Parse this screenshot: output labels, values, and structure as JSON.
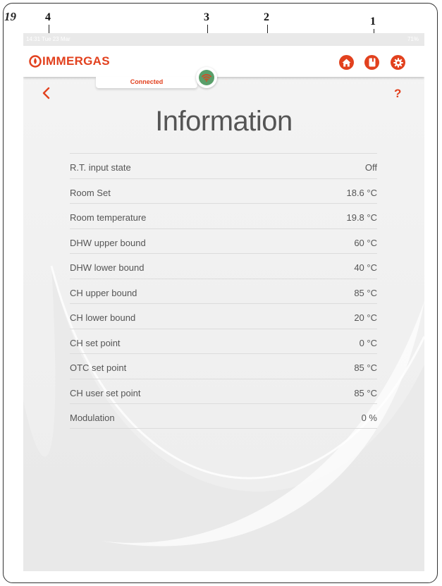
{
  "figure": {
    "number": "19",
    "callouts": [
      "1",
      "2",
      "3",
      "4"
    ]
  },
  "statusbar": {
    "time": "14:31  Tue 23 Mar",
    "battery": "71%"
  },
  "header": {
    "logo_text": "IMMERGAS",
    "icons": [
      "home-icon",
      "manual-icon",
      "settings-icon"
    ]
  },
  "connection": {
    "status": "Connected",
    "icon": "wifi-icon",
    "color": "#5a9f6a"
  },
  "nav": {
    "back_icon": "chevron-left-icon",
    "help_label": "?"
  },
  "page": {
    "title": "Information"
  },
  "info_rows": [
    {
      "label": "R.T. input state",
      "value": "Off"
    },
    {
      "label": "Room Set",
      "value": "18.6 °C"
    },
    {
      "label": "Room temperature",
      "value": "19.8 °C"
    },
    {
      "label": "DHW upper bound",
      "value": "60 °C"
    },
    {
      "label": "DHW lower bound",
      "value": "40 °C"
    },
    {
      "label": "CH upper bound",
      "value": "85 °C"
    },
    {
      "label": "CH lower bound",
      "value": "20 °C"
    },
    {
      "label": "CH set point",
      "value": "0 °C"
    },
    {
      "label": "OTC set point",
      "value": "85 °C"
    },
    {
      "label": "CH user set point",
      "value": "85 °C"
    },
    {
      "label": "Modulation",
      "value": "0 %"
    }
  ],
  "colors": {
    "accent": "#e2411e",
    "text": "#555555",
    "background": "#f1f1f1"
  }
}
